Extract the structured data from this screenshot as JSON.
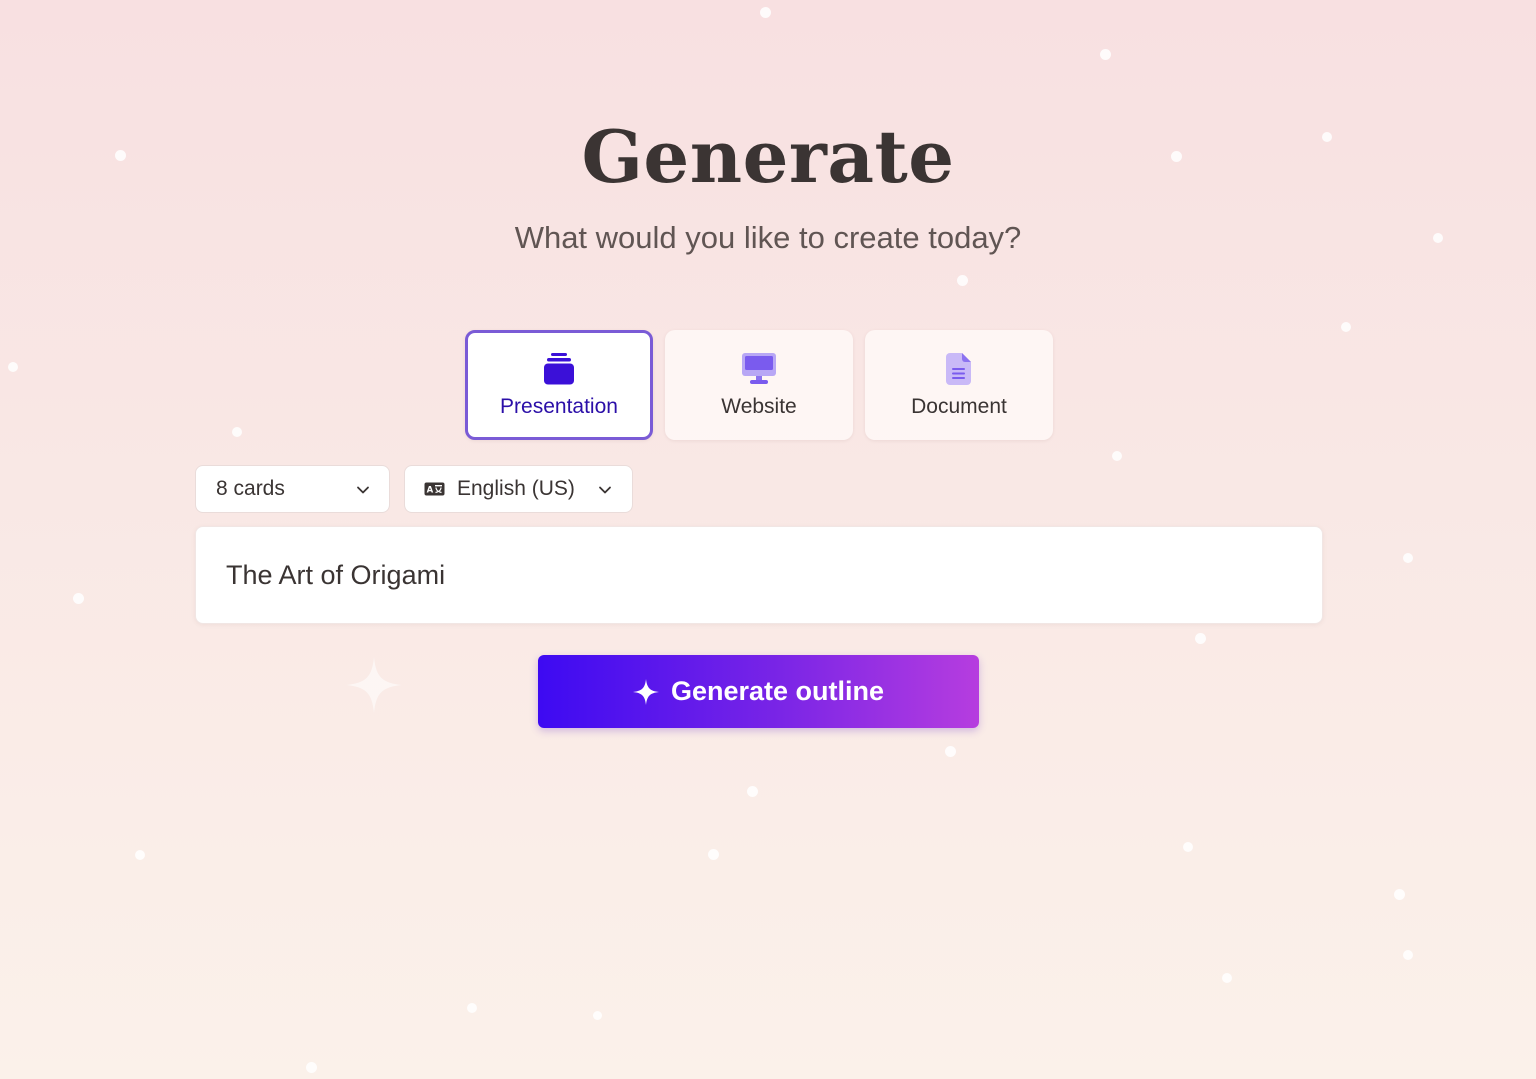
{
  "page": {
    "title": "Generate",
    "subtitle": "What would you like to create today?"
  },
  "types": [
    {
      "label": "Presentation",
      "icon": "presentation-stack-icon",
      "selected": true
    },
    {
      "label": "Website",
      "icon": "monitor-icon",
      "selected": false
    },
    {
      "label": "Document",
      "icon": "document-icon",
      "selected": false
    }
  ],
  "controls": {
    "cards_value": "8 cards",
    "language_value": "English (US)",
    "language_icon": "language-icon"
  },
  "prompt": {
    "value": "The Art of Origami"
  },
  "action": {
    "generate_label": "Generate outline",
    "icon": "sparkle-icon"
  },
  "colors": {
    "accent": "#7a5bd6",
    "selected_text": "#2b0fa8",
    "icon_primary": "#3b10d8",
    "icon_secondary": "#8c72f0",
    "icon_tertiary": "#b8a7f5",
    "button_gradient_start": "#3d0af2",
    "button_gradient_end": "#b63ddf"
  }
}
